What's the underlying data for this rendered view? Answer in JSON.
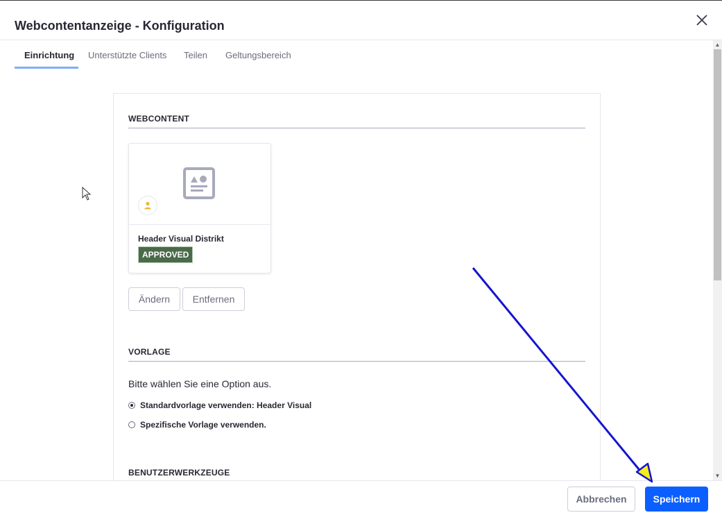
{
  "modal": {
    "title": "Webcontentanzeige - Konfiguration",
    "close_icon": "close-icon"
  },
  "tabs": [
    {
      "label": "Einrichtung",
      "active": true
    },
    {
      "label": "Unterstützte Clients",
      "active": false
    },
    {
      "label": "Teilen",
      "active": false
    },
    {
      "label": "Geltungsbereich",
      "active": false
    }
  ],
  "webcontent": {
    "section_title": "WEBCONTENT",
    "card": {
      "name": "Header Visual Distrikt",
      "status": "APPROVED",
      "icon": "web-content-article-icon",
      "sticker_icon": "user-icon"
    },
    "change_label": "Ändern",
    "remove_label": "Entfernen"
  },
  "template": {
    "section_title": "VORLAGE",
    "help_text": "Bitte wählen Sie eine Option aus.",
    "options": [
      {
        "label": "Standardvorlage verwenden: Header Visual",
        "checked": true
      },
      {
        "label": "Spezifische Vorlage verwenden.",
        "checked": false
      }
    ]
  },
  "user_tools": {
    "section_title": "BENUTZERWERKZEUGE"
  },
  "footer": {
    "cancel_label": "Abbrechen",
    "save_label": "Speichern"
  },
  "colors": {
    "primary": "#0b5fff",
    "tab_underline": "#80acff",
    "approved_badge": "#4a6a4a",
    "annotation_arrow": "#1515d0",
    "annotation_arrow_head": "#f4ef1a"
  }
}
